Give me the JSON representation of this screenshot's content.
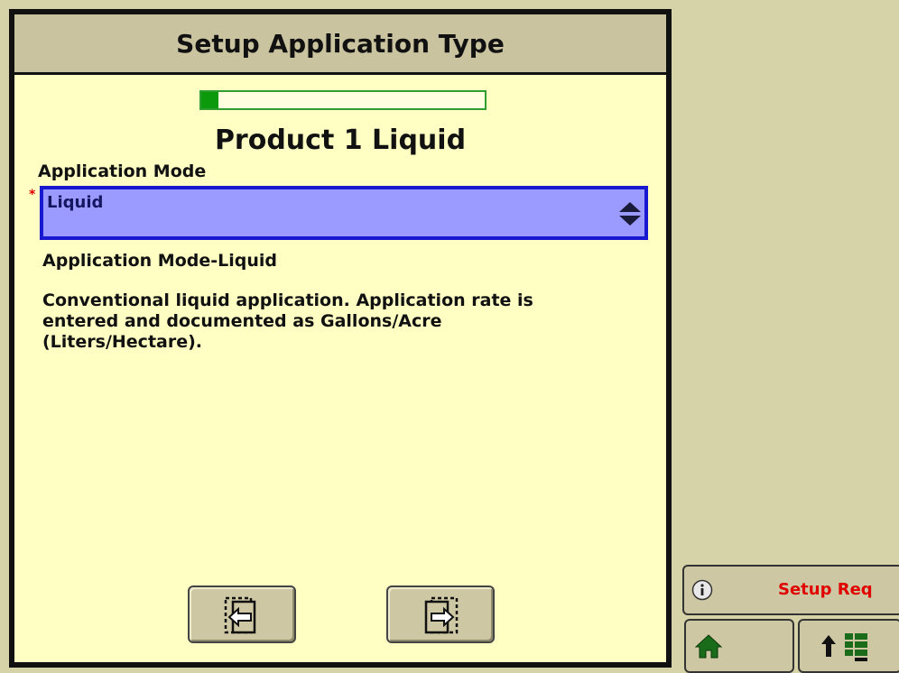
{
  "dialog": {
    "title": "Setup Application Type",
    "progress_fraction": 0.06,
    "product_title": "Product 1 Liquid",
    "field_label": "Application Mode",
    "required_marker": "*",
    "select": {
      "value": "Liquid",
      "icon": "up-down-arrows-icon"
    },
    "description_title": "Application Mode-Liquid",
    "description_lines": [
      "Conventional liquid application.  Application rate is",
      "entered and documented as Gallons/Acre",
      "(Liters/Hectare)."
    ],
    "nav": {
      "back_icon": "page-back-icon",
      "next_icon": "page-next-icon"
    }
  },
  "sidebar": {
    "status_icon": "info-icon",
    "status_text": "Setup Req",
    "home_icon": "home-icon",
    "menu_icon": "up-arrow-menu-icon"
  },
  "colors": {
    "dialog_bg": "#ffffc4",
    "title_bar_bg": "#c9c39f",
    "page_bg": "#d6d3a8",
    "select_bg": "#9b9bff",
    "select_border": "#1818d0",
    "progress_green": "#0c9a0c",
    "status_red": "#e00000"
  }
}
